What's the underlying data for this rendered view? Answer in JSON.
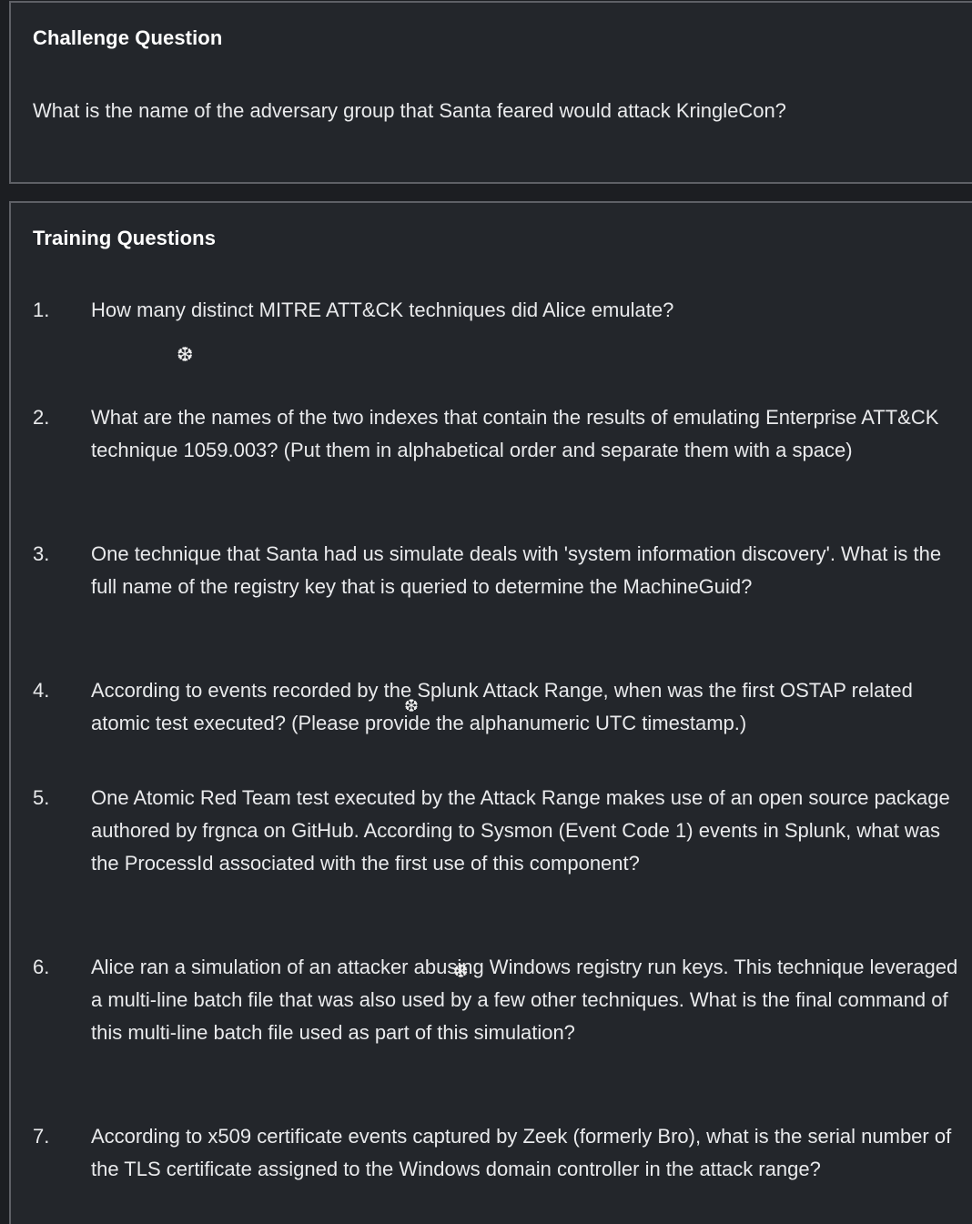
{
  "challenge": {
    "title": "Challenge Question",
    "question": "What is the name of the adversary group that Santa feared would attack KringleCon?"
  },
  "training": {
    "title": "Training Questions",
    "questions": [
      {
        "num": "1.",
        "text": "How many distinct MITRE ATT&CK techniques did Alice emulate?"
      },
      {
        "num": "2.",
        "text": "What are the names of the two indexes that contain the results of emulating Enterprise ATT&CK technique 1059.003? (Put them in alphabetical order and separate them with a space)"
      },
      {
        "num": "3.",
        "text": "One technique that Santa had us simulate deals with 'system information discovery'. What is the full name of the registry key that is queried to determine the MachineGuid?"
      },
      {
        "num": "4.",
        "text": "According to events recorded by the Splunk Attack Range, when was the first OSTAP related atomic test executed? (Please provide the alphanumeric UTC timestamp.)"
      },
      {
        "num": "5.",
        "text": "One Atomic Red Team test executed by the Attack Range makes use of an open source package authored by frgnca on GitHub. According to Sysmon (Event Code 1) events in Splunk, what was the ProcessId associated with the first use of this component?"
      },
      {
        "num": "6.",
        "text": "Alice ran a simulation of an attacker abusing Windows registry run keys. This technique leveraged a multi-line batch file that was also used by a few other techniques. What is the final command of this multi-line batch file used as part of this simulation?"
      },
      {
        "num": "7.",
        "text": "According to x509 certificate events captured by Zeek (formerly Bro), what is the serial number of the TLS certificate assigned to the Windows domain controller in the attack range?"
      }
    ]
  },
  "decorations": {
    "snowflake_glyph": "❆",
    "snowflake_icon": "snowflake-icon"
  }
}
